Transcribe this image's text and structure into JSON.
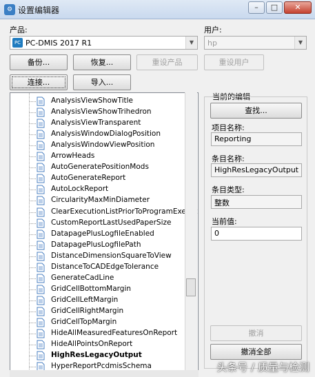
{
  "window": {
    "title": "设置编辑器",
    "minimize": "–",
    "maximize": "□",
    "close": "✕",
    "icon": "gear-icon"
  },
  "product": {
    "label": "产品:",
    "value": "PC-DMIS 2017 R1",
    "logo": "PC"
  },
  "user": {
    "label": "用户:",
    "value": "hp"
  },
  "buttons": {
    "backup": "备份...",
    "restore": "恢复...",
    "reset_product": "重设产品",
    "reset_user": "重设用户",
    "connect": "连接...",
    "import": "导入..."
  },
  "tree": {
    "items": [
      "AnalysisViewShowTitle",
      "AnalysisViewShowTrihedron",
      "AnalysisViewTransparent",
      "AnalysisWindowDialogPosition",
      "AnalysisWindowViewPosition",
      "ArrowHeads",
      "AutoGeneratePositionMods",
      "AutoGenerateReport",
      "AutoLockReport",
      "CircularityMaxMinDiameter",
      "ClearExecutionListPriorToProgramExecut",
      "CustomReportLastUsedPaperSize",
      "DatapagePlusLogfileEnabled",
      "DatapagePlusLogfilePath",
      "DistanceDimensionSquareToView",
      "DistanceToCADEdgeTolerance",
      "GenerateCadLine",
      "GridCellBottomMargin",
      "GridCellLeftMargin",
      "GridCellRightMargin",
      "GridCellTopMargin",
      "HideAllMeasuredFeaturesOnReport",
      "HideAllPointsOnReport",
      "HighResLegacyOutput",
      "HyperReportPcdmisSchema"
    ],
    "selected_index": 23
  },
  "edit": {
    "title": "当前的编辑",
    "find_button": "查找...",
    "section_label": "项目名称:",
    "section_value": "Reporting",
    "entry_label": "条目名称:",
    "entry_value": "HighResLegacyOutput",
    "type_label": "条目类型:",
    "type_value": "整数",
    "current_label": "当前值:",
    "current_value": "0",
    "undo_button": "撤消",
    "undo_all_button": "撤消全部"
  },
  "watermark": "头条号 / 质量与检测",
  "colors": {
    "titlebar": "#c9d9ee",
    "close_button": "#c5412f",
    "doc_icon": "#4a7fc1"
  }
}
